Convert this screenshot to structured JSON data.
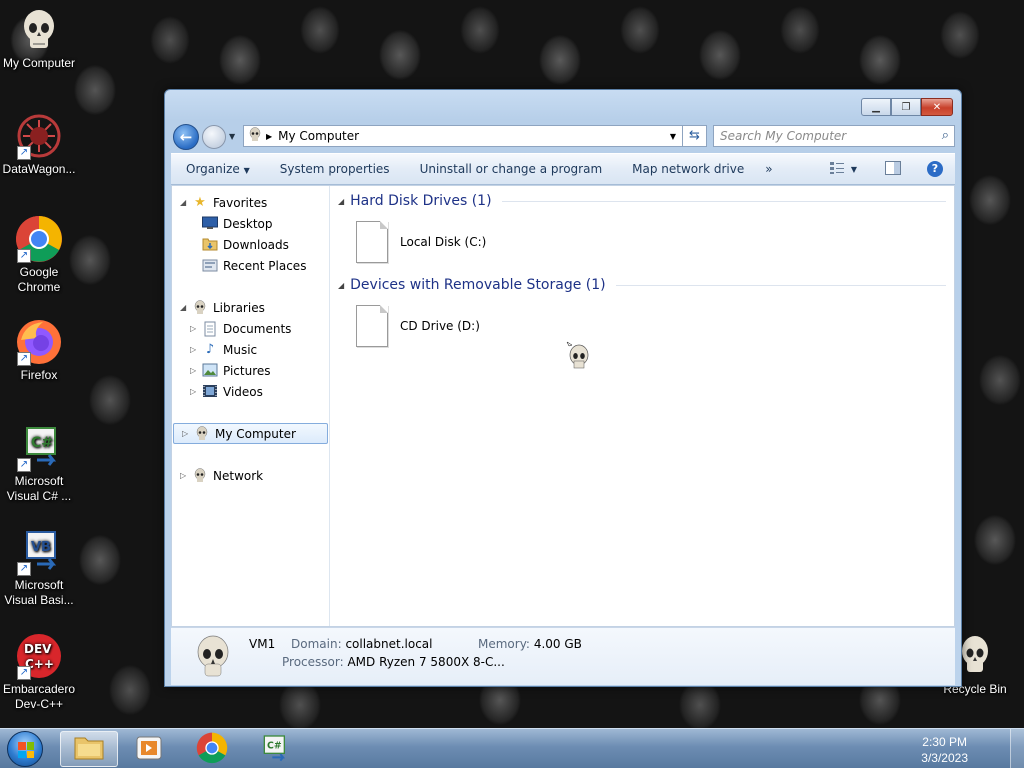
{
  "desktop": {
    "icons": [
      {
        "label": "My Computer",
        "icon": "skull-icon"
      },
      {
        "label": "DataWagon...",
        "icon": "datawagon-icon"
      },
      {
        "label": "Google Chrome",
        "icon": "chrome-icon"
      },
      {
        "label": "Firefox",
        "icon": "firefox-icon"
      },
      {
        "label": "Microsoft Visual C# ...",
        "icon": "visual-csharp-icon"
      },
      {
        "label": "Microsoft Visual Basi...",
        "icon": "visual-basic-icon"
      },
      {
        "label": "Embarcadero Dev-C++",
        "icon": "devcpp-icon"
      },
      {
        "label": "Recycle Bin",
        "icon": "recycle-bin-icon"
      }
    ]
  },
  "window": {
    "address": "My Computer",
    "search_placeholder": "Search My Computer",
    "toolbar": {
      "organize": "Organize",
      "system_properties": "System properties",
      "uninstall": "Uninstall or change a program",
      "map_drive": "Map network drive",
      "more": "»"
    },
    "nav": {
      "favorites": "Favorites",
      "desktop": "Desktop",
      "downloads": "Downloads",
      "recent_places": "Recent Places",
      "libraries": "Libraries",
      "documents": "Documents",
      "music": "Music",
      "pictures": "Pictures",
      "videos": "Videos",
      "my_computer": "My Computer",
      "network": "Network"
    },
    "groups": [
      {
        "title": "Hard Disk Drives (1)",
        "items": [
          "Local Disk (C:)"
        ]
      },
      {
        "title": "Devices with Removable Storage (1)",
        "items": [
          "CD Drive (D:)"
        ]
      }
    ],
    "details": {
      "name": "VM1",
      "domain_label": "Domain:",
      "domain": "collabnet.local",
      "memory_label": "Memory:",
      "memory": "4.00 GB",
      "processor_label": "Processor:",
      "processor": "AMD Ryzen 7 5800X 8-C..."
    }
  },
  "taskbar": {
    "time": "2:30 PM",
    "date": "3/3/2023"
  },
  "colors": {
    "group_heading": "#1e3287",
    "toolbar_text": "#1e395b",
    "close_button": "#c8402b"
  }
}
